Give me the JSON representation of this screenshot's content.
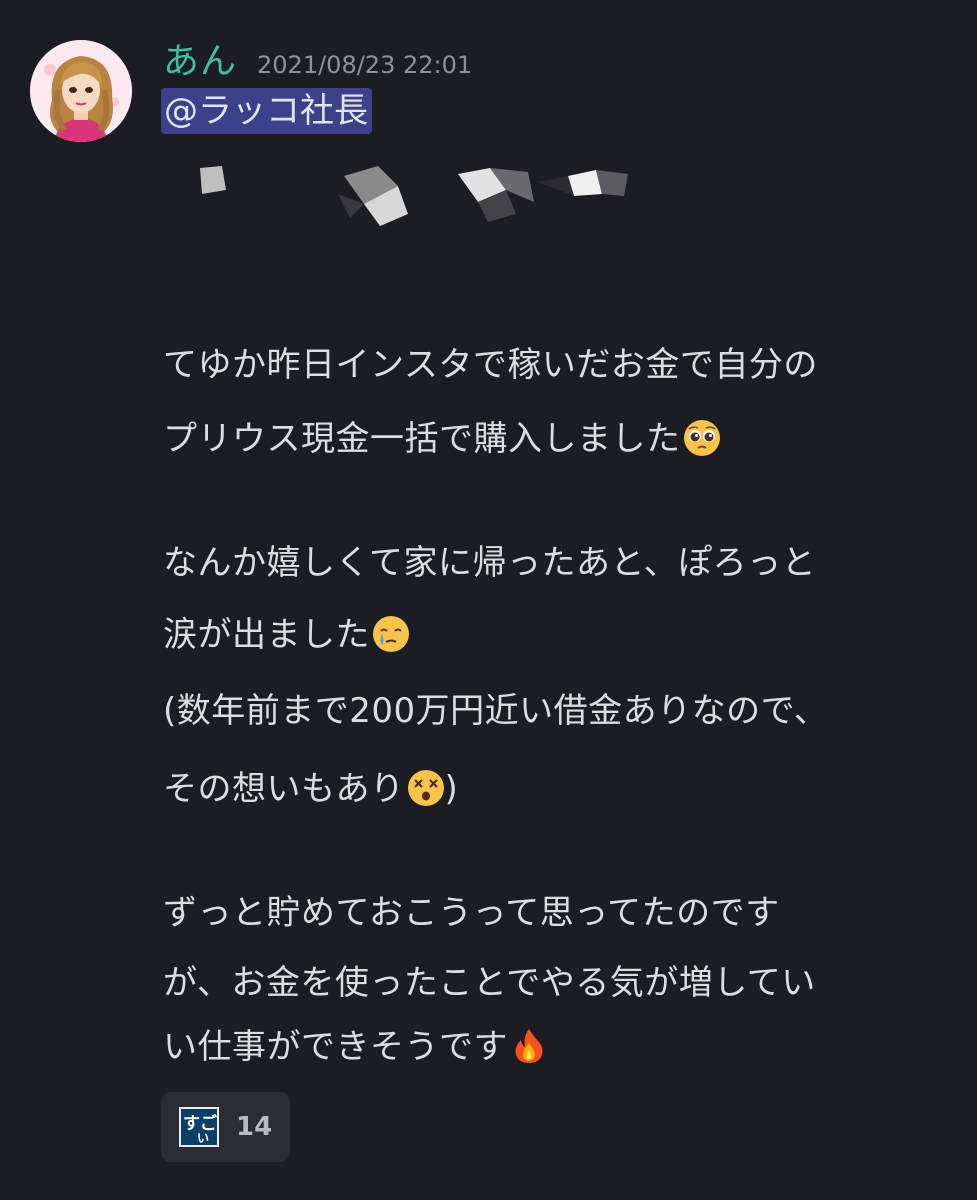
{
  "message": {
    "username": "あん",
    "timestamp": "2021/08/23 22:01",
    "mention": "@ラッコ社長",
    "lines": [
      "てゆか昨日インスタで稼いだお金で自分の",
      "プリウス現金一括で購入しました",
      "なんか嬉しくて家に帰ったあと、ぽろっと",
      "涙が出ました",
      "(数年前まで200万円近い借金ありなので、",
      "その想いもあり",
      ")",
      "ずっと貯めておこうって思ってたのです",
      "が、お金を使ったことでやる気が増してい",
      "い仕事ができそうです"
    ],
    "emoji_names": [
      "pleading-face-icon",
      "face-holding-back-tears-icon",
      "dizzy-face-icon",
      "fire-icon"
    ]
  },
  "reaction": {
    "emoji_name": "sugoi-custom-emoji-icon",
    "emoji_text": "すごい",
    "count": "14"
  },
  "colors": {
    "background": "#1c1d22",
    "username": "#3fbf9f",
    "mention_bg": "#3c418a",
    "text": "#dcddde",
    "timestamp": "#8e9297",
    "reaction_bg": "#2b2d33"
  }
}
